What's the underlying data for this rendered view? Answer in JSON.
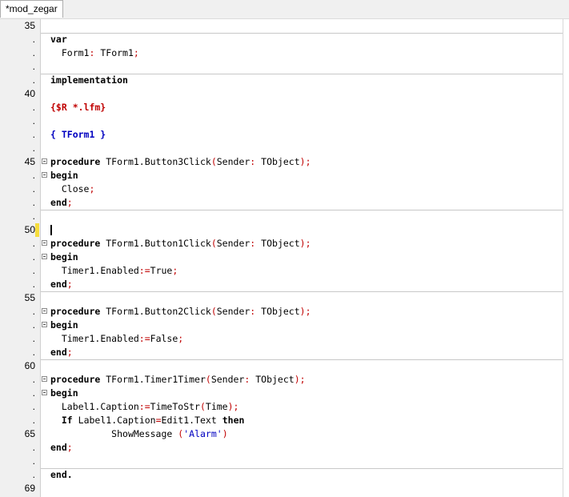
{
  "tab": {
    "label": "*mod_zegar"
  },
  "gutter": {
    "l35": "35",
    "l40": "40",
    "l45": "45",
    "l50": "50",
    "l55": "55",
    "l60": "60",
    "l65": "65",
    "l69": "69",
    "dot": "."
  },
  "code": {
    "var": "var",
    "form1_decl": "Form1: TForm1",
    "semi": ";",
    "colon": ":",
    "implementation": "implementation",
    "directive": "{$R *.lfm}",
    "comment": "{ TForm1 }",
    "procedure": "procedure",
    "begin": "begin",
    "end": "end",
    "end_final": "end.",
    "b3_name": "TForm1.Button3Click",
    "b1_name": "TForm1.Button1Click",
    "b2_name": "TForm1.Button2Click",
    "t1_name": "TForm1.Timer1Timer",
    "params": "Sender",
    "param_type": "TObject",
    "lparen": "(",
    "rparen": ")",
    "close": "Close",
    "timer_enabled": "Timer1.Enabled",
    "assign": ":=",
    "true": "True",
    "false": "False",
    "label_caption": "Label1.Caption",
    "timetostr": "TimeToStr",
    "time": "Time",
    "if": "If",
    "eq": "=",
    "edit_text": "Edit1.Text",
    "then": "then",
    "showmessage": "ShowMessage",
    "alarm": "'Alarm'"
  }
}
